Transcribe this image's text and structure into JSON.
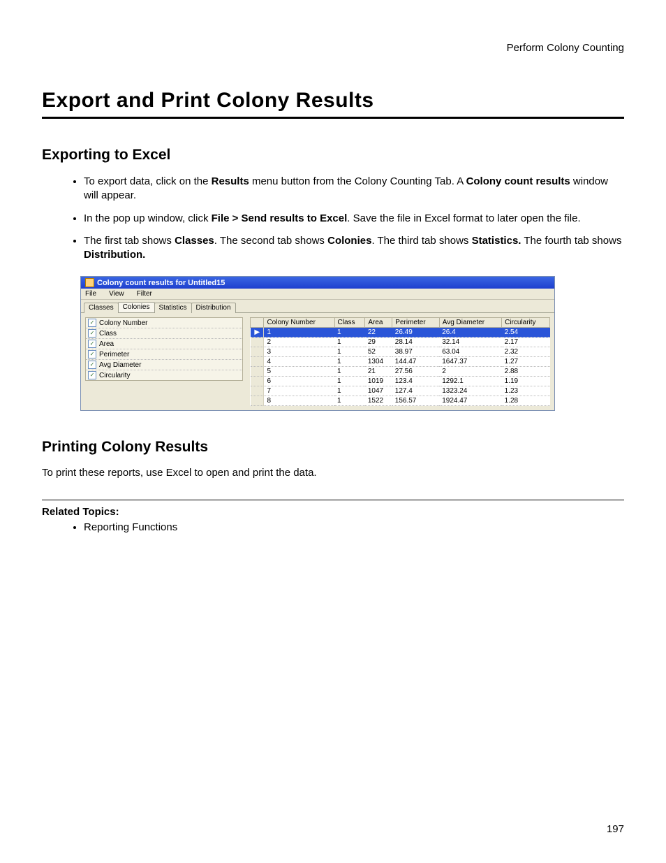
{
  "header": {
    "running_head": "Perform Colony Counting"
  },
  "title": "Export and Print Colony Results",
  "section1": {
    "heading": "Exporting to Excel",
    "bullets": [
      {
        "pre": "To export data, click on the ",
        "bold1": "Results",
        "mid": " menu button from the Colony Counting Tab. A ",
        "bold2": "Colony count results",
        "post": " window will appear."
      },
      {
        "pre": "In the pop up window, click ",
        "bold1": "File > Send results to Excel",
        "mid": ". Save the file in Excel format to later open the file.",
        "bold2": "",
        "post": ""
      },
      {
        "pre": "The first tab shows ",
        "bold1": "Classes",
        "mid": ". The second tab shows ",
        "bold2": "Colonies",
        "post_ext": ". The third tab shows ",
        "bold3": "Statistics.",
        "post_ext2": " The fourth tab shows ",
        "bold4": "Distribution."
      }
    ]
  },
  "appwindow": {
    "title": "Colony count results for Untitled15",
    "menus": [
      "File",
      "View",
      "Filter"
    ],
    "tabs": [
      "Classes",
      "Colonies",
      "Statistics",
      "Distribution"
    ],
    "active_tab": 1,
    "checklist": [
      "Colony Number",
      "Class",
      "Area",
      "Perimeter",
      "Avg Diameter",
      "Circularity"
    ],
    "columns": [
      "Colony Number",
      "Class",
      "Area",
      "Perimeter",
      "Avg Diameter",
      "Circularity"
    ],
    "rows": [
      {
        "sel": true,
        "n": "1",
        "class": "1",
        "area": "22",
        "perim": "26.49",
        "avgd": "26.4",
        "circ": "2.54"
      },
      {
        "sel": false,
        "n": "2",
        "class": "1",
        "area": "29",
        "perim": "28.14",
        "avgd": "32.14",
        "circ": "2.17"
      },
      {
        "sel": false,
        "n": "3",
        "class": "1",
        "area": "52",
        "perim": "38.97",
        "avgd": "63.04",
        "circ": "2.32"
      },
      {
        "sel": false,
        "n": "4",
        "class": "1",
        "area": "1304",
        "perim": "144.47",
        "avgd": "1647.37",
        "circ": "1.27"
      },
      {
        "sel": false,
        "n": "5",
        "class": "1",
        "area": "21",
        "perim": "27.56",
        "avgd": "2",
        "circ": "2.88"
      },
      {
        "sel": false,
        "n": "6",
        "class": "1",
        "area": "1019",
        "perim": "123.4",
        "avgd": "1292.1",
        "circ": "1.19"
      },
      {
        "sel": false,
        "n": "7",
        "class": "1",
        "area": "1047",
        "perim": "127.4",
        "avgd": "1323.24",
        "circ": "1.23"
      },
      {
        "sel": false,
        "n": "8",
        "class": "1",
        "area": "1522",
        "perim": "156.57",
        "avgd": "1924.47",
        "circ": "1.28"
      }
    ]
  },
  "section2": {
    "heading": "Printing Colony Results",
    "body": "To print these reports, use Excel to open and print the data."
  },
  "related": {
    "heading": "Related Topics:",
    "items": [
      "Reporting Functions"
    ]
  },
  "page_number": "197"
}
